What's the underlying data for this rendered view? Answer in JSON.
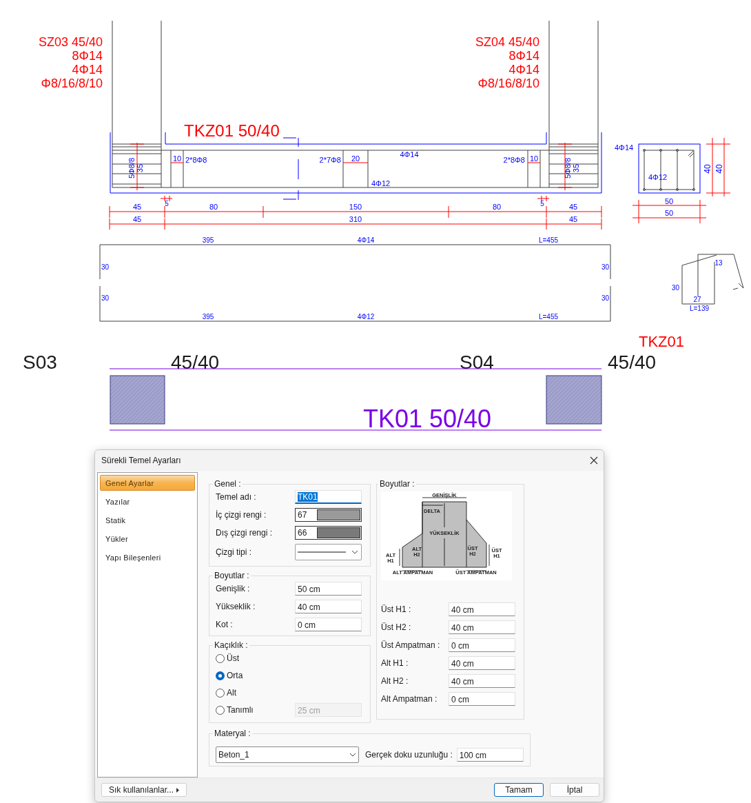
{
  "drawing": {
    "column_labels": [
      {
        "lines": [
          "SZ03 45/40",
          "8Φ14",
          "4Φ14",
          "Φ8/16/8/10"
        ]
      },
      {
        "lines": [
          "SZ04 45/40",
          "8Φ14",
          "4Φ14",
          "Φ8/16/8/10"
        ]
      }
    ],
    "beam_label": "TKZ01 50/40",
    "elevation_notes": [
      "5Φ8/8",
      "35",
      "10",
      "2*8Φ8",
      "2*7Φ8",
      "20",
      "4Φ14",
      "4Φ12",
      "2*8Φ8",
      "10",
      "5Φ8/8",
      "35"
    ],
    "dimensions": {
      "offsets": [
        "5",
        "5"
      ],
      "row_1": [
        "45",
        "80",
        "150",
        "80",
        "45"
      ],
      "row_2": [
        "45",
        "310",
        "45"
      ]
    },
    "section": {
      "top_bars": "4Φ14",
      "bottom_bars": "4Φ12",
      "widths": [
        "50",
        "50"
      ],
      "heights": [
        "40",
        "40"
      ]
    },
    "bars": [
      {
        "hooks": [
          "30",
          "30"
        ],
        "straight": "395",
        "mark": "4Φ14",
        "length": "L=455"
      },
      {
        "hooks": [
          "30",
          "30"
        ],
        "straight": "395",
        "mark": "4Φ12",
        "length": "L=455"
      }
    ],
    "stirrup": {
      "hook": "13",
      "side": "30",
      "base": "27",
      "length": "L=139"
    },
    "plan": {
      "tie_label": "TKZ01",
      "columns": [
        {
          "name": "S03",
          "size": "45/40"
        },
        {
          "name": "S04",
          "size": "45/40"
        }
      ],
      "beam_label": "TK01 50/40"
    }
  },
  "dialog": {
    "title": "Sürekli Temel Ayarları",
    "nav": [
      {
        "label": "Genel Ayarlar",
        "selected": true
      },
      {
        "label": "Yazılar",
        "selected": false
      },
      {
        "label": "Statik",
        "selected": false
      },
      {
        "label": "Yükler",
        "selected": false
      },
      {
        "label": "Yapı Bileşenleri",
        "selected": false
      }
    ],
    "genel": {
      "title": "Genel :",
      "fields": [
        {
          "kind": "text",
          "label": "Temel adı :",
          "value": "TK01",
          "focused": true
        },
        {
          "kind": "color",
          "label": "İç çizgi rengi :",
          "value": "67",
          "color": "#9a9a9a"
        },
        {
          "kind": "color",
          "label": "Dış çizgi rengi :",
          "value": "66",
          "color": "#7a7a7a"
        },
        {
          "kind": "line",
          "label": "Çizgi tipi :"
        }
      ]
    },
    "boyutlar": {
      "title": "Boyutlar :",
      "fields": [
        {
          "label": "Genişlik :",
          "value": "50 cm"
        },
        {
          "label": "Yükseklik :",
          "value": "40 cm"
        },
        {
          "label": "Kot :",
          "value": "0 cm"
        }
      ]
    },
    "kaciklik": {
      "title": "Kaçıklık :",
      "options": [
        {
          "label": "Üst",
          "selected": false
        },
        {
          "label": "Orta",
          "selected": true
        },
        {
          "label": "Alt",
          "selected": false
        },
        {
          "label": "Tanımlı",
          "selected": false,
          "value": "25 cm",
          "disabled": true
        }
      ]
    },
    "section_panel": {
      "title": "Boyutlar :",
      "diagram_labels": [
        {
          "lines": [
            "GENİŞLİK"
          ]
        },
        {
          "lines": [
            "DELTA"
          ]
        },
        {
          "lines": [
            "YÜKSEKLİK"
          ]
        },
        {
          "lines": [
            "ALT",
            "H2"
          ]
        },
        {
          "lines": [
            "ÜST",
            "H2"
          ]
        },
        {
          "lines": [
            "ALT",
            "H1"
          ]
        },
        {
          "lines": [
            "ÜST",
            "H1"
          ]
        },
        {
          "lines": [
            "ALT AMPATMAN"
          ]
        },
        {
          "lines": [
            "ÜST AMPATMAN"
          ]
        }
      ],
      "fields": [
        {
          "label": "Üst H1 :",
          "value": "40 cm"
        },
        {
          "label": "Üst H2 :",
          "value": "40 cm"
        },
        {
          "label": "Üst Ampatman :",
          "value": "0 cm"
        },
        {
          "label": "Alt H1 :",
          "value": "40 cm"
        },
        {
          "label": "Alt H2 :",
          "value": "40 cm"
        },
        {
          "label": "Alt Ampatman :",
          "value": "0 cm"
        }
      ]
    },
    "materyal": {
      "title": "Materyal :",
      "value": "Beton_1",
      "texture_label": "Gerçek doku uzunluğu :",
      "texture_value": "100 cm"
    },
    "footer": {
      "favorites": "Sık kullanılanlar...",
      "ok": "Tamam",
      "cancel": "İptal"
    }
  }
}
